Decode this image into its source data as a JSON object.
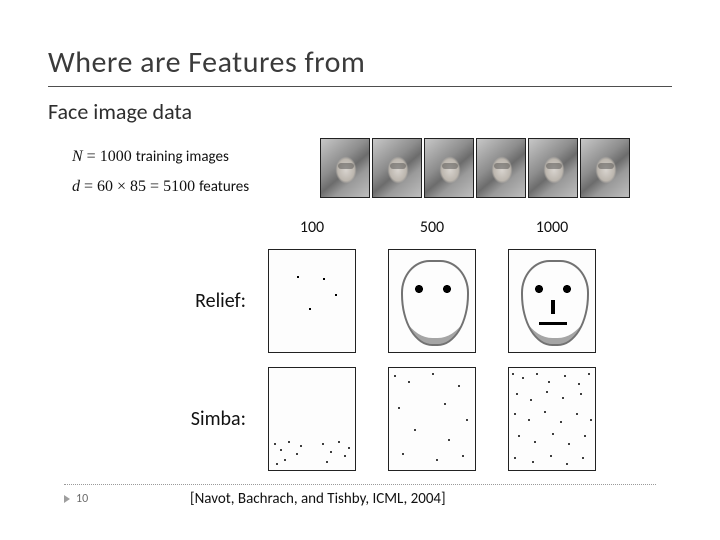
{
  "title": "Where are Features from",
  "subtitle": "Face image data",
  "formula1": {
    "n_sym": "N",
    "eq1": " = 1000 ",
    "trail1": "training images"
  },
  "formula2": {
    "d_sym": "d",
    "eq2": " = 60 × 85 = 5100 ",
    "trail2": "features"
  },
  "columns": [
    "100",
    "500",
    "1000"
  ],
  "rows": [
    "Relief:",
    "Simba:"
  ],
  "page_number": "10",
  "citation": "[Navot, Bachrach, and Tishby, ICML, 2004]",
  "sample_count": 6
}
